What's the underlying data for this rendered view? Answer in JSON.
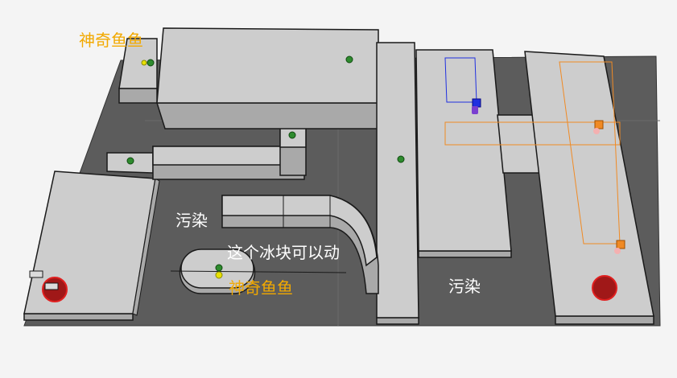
{
  "labels": {
    "magic_fish_top": "神奇鱼鱼",
    "magic_fish_bottom": "神奇鱼鱼",
    "pollution_left": "污染",
    "pollution_right": "污染",
    "ice_movable": "这个冰块可以动"
  },
  "colors": {
    "background": "#f4f4f4",
    "floor": "#5c5c5c",
    "block_top": "#cdcdcd",
    "block_side": "#a9a9a9",
    "edge": "#1a1a1a",
    "marker_green": "#2e8b2e",
    "marker_yellow": "#e8e000",
    "marker_red": "#cc2020",
    "path_blue": "#2030e0",
    "path_orange": "#f08a24",
    "label_yellow": "#f2a900",
    "label_white": "#ffffff"
  },
  "icons": {
    "goal": "red-circle-icon",
    "spawn": "green-dot-icon",
    "fish": "yellow-dot-icon",
    "enemy": "orange-square-icon",
    "player": "blue-square-icon"
  }
}
